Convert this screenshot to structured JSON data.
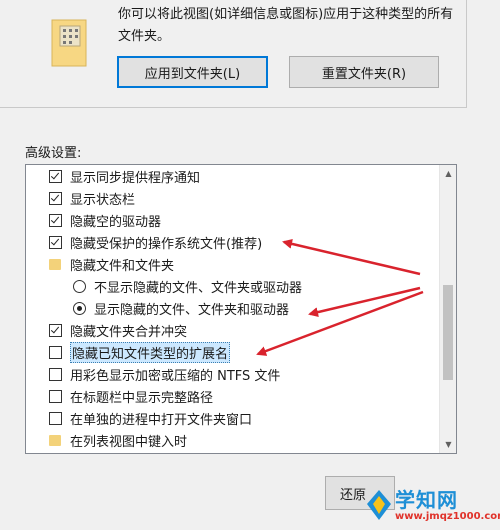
{
  "folder_views": {
    "description": "你可以将此视图(如详细信息或图标)应用于这种类型的所有文件夹。",
    "apply_button": "应用到文件夹(L)",
    "reset_button": "重置文件夹(R)"
  },
  "advanced": {
    "label": "高级设置:",
    "items": [
      {
        "type": "checkbox",
        "checked": true,
        "label": "显示同步提供程序通知"
      },
      {
        "type": "checkbox",
        "checked": true,
        "label": "显示状态栏"
      },
      {
        "type": "checkbox",
        "checked": true,
        "label": "隐藏空的驱动器"
      },
      {
        "type": "checkbox",
        "checked": true,
        "label": "隐藏受保护的操作系统文件(推荐)"
      },
      {
        "type": "folder",
        "label": "隐藏文件和文件夹"
      },
      {
        "type": "radio",
        "checked": false,
        "label": "不显示隐藏的文件、文件夹或驱动器"
      },
      {
        "type": "radio",
        "checked": true,
        "label": "显示隐藏的文件、文件夹和驱动器"
      },
      {
        "type": "checkbox",
        "checked": true,
        "label": "隐藏文件夹合并冲突"
      },
      {
        "type": "checkbox",
        "checked": false,
        "label": "隐藏已知文件类型的扩展名",
        "selected": true
      },
      {
        "type": "checkbox",
        "checked": false,
        "label": "用彩色显示加密或压缩的 NTFS 文件"
      },
      {
        "type": "checkbox",
        "checked": false,
        "label": "在标题栏中显示完整路径"
      },
      {
        "type": "checkbox",
        "checked": false,
        "label": "在单独的进程中打开文件夹窗口"
      },
      {
        "type": "folder",
        "label": "在列表视图中键入时"
      }
    ]
  },
  "footer": {
    "restore_button": "还原"
  },
  "watermark": {
    "title": "学知网",
    "url": "www.jmqz1000.com"
  },
  "colors": {
    "arrow": "#d9232d",
    "selection_bg": "#cce8ff",
    "accent": "#0078d7"
  }
}
